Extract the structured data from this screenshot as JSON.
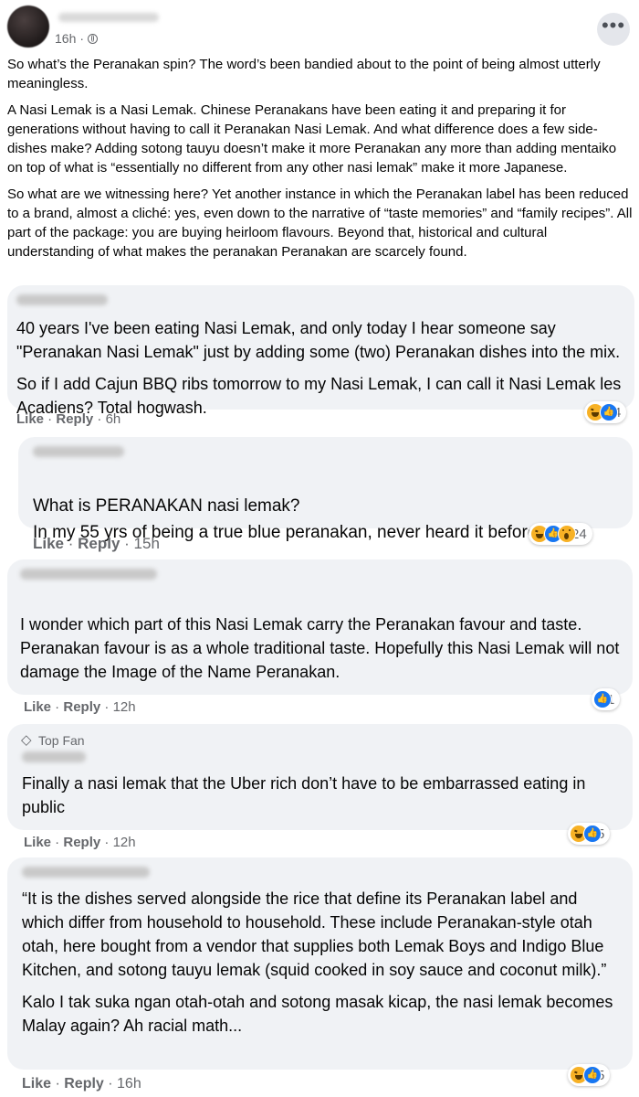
{
  "post": {
    "time": "16h",
    "dot": "·",
    "more": "•••",
    "paragraphs": [
      "So what’s the Peranakan spin? The word’s been bandied about to the point of being almost utterly meaningless.",
      "A Nasi Lemak is a Nasi Lemak. Chinese Peranakans have been eating it and preparing it for generations without having to call it Peranakan Nasi Lemak. And what difference does a few side-dishes make? Adding sotong tauyu doesn’t make it more Peranakan any more than adding mentaiko on top of what is “essentially no different from any other nasi lemak” make it more Japanese.",
      "So what are we witnessing here? Yet another instance in which the Peranakan label has been reduced to a brand, almost a cliché: yes, even down to the narrative of “taste memories” and “family recipes”. All part of the package: you are buying heirloom flavours. Beyond that, historical and cultural understanding of what makes the peranakan Peranakan are scarcely found."
    ]
  },
  "comments": [
    {
      "paragraphs": [
        "40 years I've been eating Nasi Lemak, and only today I hear someone say \"Peranakan Nasi Lemak\" just by adding some (two) Peranakan dishes into the mix.",
        "So if I add Cajun BBQ ribs tomorrow to my Nasi Lemak, I can call it Nasi Lemak les Acadiens? Total hogwash."
      ],
      "like": "Like",
      "reply": "Reply",
      "time": "6h",
      "reaction_count": "4"
    },
    {
      "paragraphs": [
        "What is PERANAKAN nasi lemak?\nIn my 55 yrs of being a true blue peranakan, never heard it before."
      ],
      "like": "Like",
      "reply": "Reply",
      "time": "15h",
      "reaction_count": "24"
    },
    {
      "paragraphs": [
        "I wonder which part of this Nasi Lemak carry the Peranakan favour and taste.\nPeranakan favour is as a whole traditional taste. Hopefully this Nasi Lemak will not damage the Image of the Name Peranakan."
      ],
      "like": "Like",
      "reply": "Reply",
      "time": "12h",
      "reaction_count": "1"
    },
    {
      "badge": "Top Fan",
      "paragraphs": [
        "Finally a nasi lemak that the Uber rich don’t have to be embarrassed eating in public"
      ],
      "like": "Like",
      "reply": "Reply",
      "time": "12h",
      "reaction_count": "5"
    },
    {
      "paragraphs": [
        "“It is the dishes served alongside the rice that define its Peranakan label and which differ from household to household. These include Peranakan-style otah otah, here bought from a vendor that supplies both Lemak Boys and Indigo Blue Kitchen, and sotong tauyu lemak (squid cooked in soy sauce and coconut milk).”",
        "Kalo I tak suka ngan otah-otah and sotong masak kicap, the nasi lemak becomes Malay again? Ah racial math..."
      ],
      "like": "Like",
      "reply": "Reply",
      "time": "16h",
      "reaction_count": "5"
    }
  ]
}
